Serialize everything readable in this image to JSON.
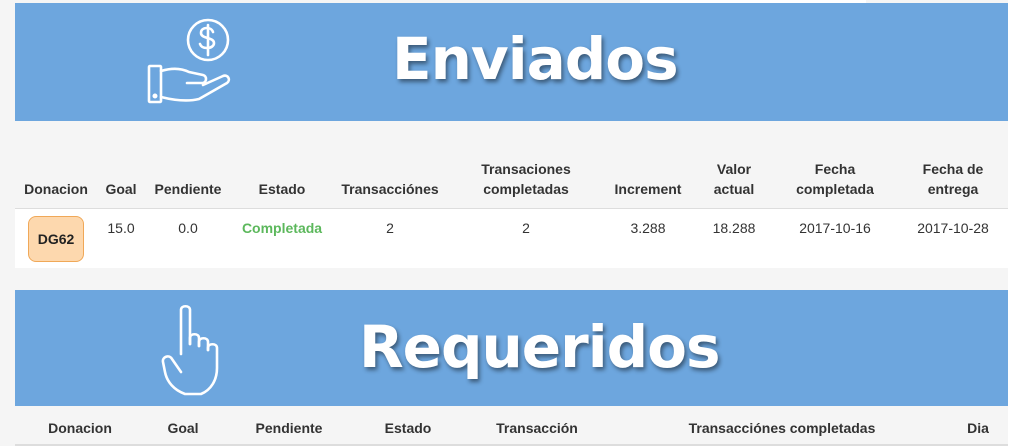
{
  "colors": {
    "banner": "#6da6de",
    "badge_bg": "#fdd8ae",
    "badge_border": "#f0a858",
    "status_complete": "#5cb85c"
  },
  "sent": {
    "title": "Enviados",
    "icon": "hand-dollar-icon",
    "headers": {
      "donacion": "Donacion",
      "goal": "Goal",
      "pendiente": "Pendiente",
      "estado": "Estado",
      "transacciones": "Transacciónes",
      "transacciones_completadas_1": "Transaciones",
      "transacciones_completadas_2": "completadas",
      "increment": "Increment",
      "valor_actual_1": "Valor",
      "valor_actual_2": "actual",
      "fecha_completada_1": "Fecha",
      "fecha_completada_2": "completada",
      "fecha_entrega_1": "Fecha de",
      "fecha_entrega_2": "entrega"
    },
    "rows": [
      {
        "donacion": "DG62",
        "goal": "15.0",
        "pendiente": "0.0",
        "estado": "Completada",
        "transacciones": "2",
        "transacciones_completadas": "2",
        "increment": "3.288",
        "valor_actual": "18.288",
        "fecha_completada": "2017-10-16",
        "fecha_entrega": "2017-10-28"
      }
    ]
  },
  "requested": {
    "title": "Requeridos",
    "icon": "pointing-hand-icon",
    "headers": {
      "donacion": "Donacion",
      "goal": "Goal",
      "pendiente": "Pendiente",
      "estado": "Estado",
      "transaccion": "Transacción",
      "transacciones_completadas": "Transacciónes completadas",
      "dia": "Dia"
    }
  }
}
